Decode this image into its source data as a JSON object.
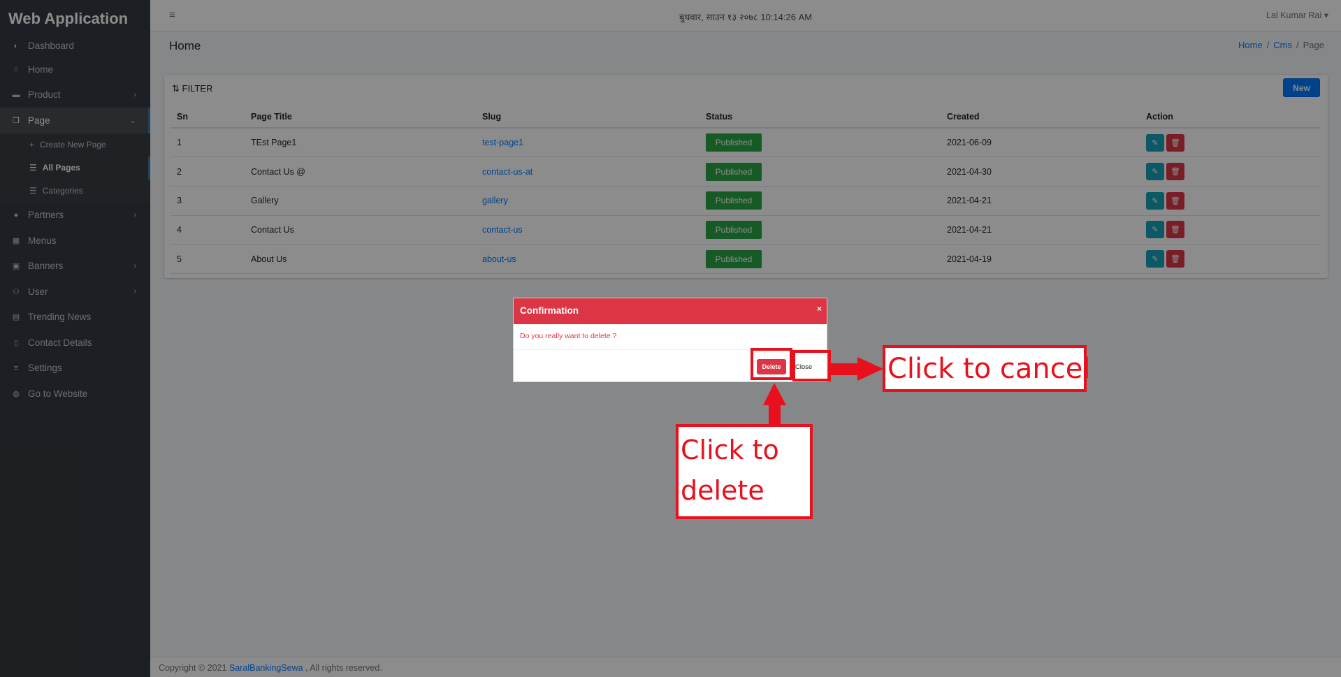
{
  "app": {
    "title": "Web Application"
  },
  "sidebar": {
    "items": [
      {
        "label": "Dashboard",
        "icon": "tachometer-icon"
      },
      {
        "label": "Home",
        "icon": "home-icon"
      },
      {
        "label": "Product",
        "icon": "product-icon",
        "has_children": true
      },
      {
        "label": "Page",
        "icon": "pages-icon",
        "expanded": true
      },
      {
        "label": "Partners",
        "icon": "user-circle-icon",
        "has_children": true
      },
      {
        "label": "Menus",
        "icon": "grid-icon"
      },
      {
        "label": "Banners",
        "icon": "images-icon",
        "has_children": true
      },
      {
        "label": "User",
        "icon": "users-icon",
        "has_children": true
      },
      {
        "label": "Trending News",
        "icon": "newspaper-icon"
      },
      {
        "label": "Contact Details",
        "icon": "address-book-icon"
      },
      {
        "label": "Settings",
        "icon": "sliders-icon"
      },
      {
        "label": "Go to Website",
        "icon": "globe-icon"
      }
    ],
    "page_sub": [
      {
        "label": "Create New Page",
        "icon": "plus-icon"
      },
      {
        "label": "All Pages",
        "icon": "list-icon",
        "active": true
      },
      {
        "label": "Categories",
        "icon": "list-icon"
      }
    ]
  },
  "header": {
    "date": "बुधवार, साउन १३ २०७८ 10:14:26 AM",
    "user": "Lal Kumar Rai"
  },
  "content": {
    "title": "Home",
    "breadcrumb": [
      "Home",
      "Cms",
      "Page"
    ]
  },
  "card": {
    "filter_label": "FILTER",
    "new_label": "New",
    "columns": [
      "Sn",
      "Page Title",
      "Slug",
      "Status",
      "Created",
      "Action"
    ],
    "rows": [
      {
        "sn": "1",
        "title": "TEst Page1",
        "slug": "test-page1",
        "status": "Published",
        "created": "2021-06-09"
      },
      {
        "sn": "2",
        "title": "Contact Us @",
        "slug": "contact-us-at",
        "status": "Published",
        "created": "2021-04-30"
      },
      {
        "sn": "3",
        "title": "Gallery",
        "slug": "gallery",
        "status": "Published",
        "created": "2021-04-21"
      },
      {
        "sn": "4",
        "title": "Contact Us",
        "slug": "contact-us",
        "status": "Published",
        "created": "2021-04-21"
      },
      {
        "sn": "5",
        "title": "About Us",
        "slug": "about-us",
        "status": "Published",
        "created": "2021-04-19"
      }
    ]
  },
  "modal": {
    "title": "Confirmation",
    "close_x": "×",
    "message": "Do you really want to delete ?",
    "delete_label": "Delete",
    "close_label": "Close"
  },
  "annotations": {
    "delete_callout": "Click to delete",
    "cancel_callout": "Click to cancel"
  },
  "footer": {
    "prefix": "Copyright © 2021 ",
    "brand": "SaralBankingSewa",
    "suffix": " , All rights reserved."
  },
  "colors": {
    "sidebar_bg": "#343a40",
    "primary": "#007bff",
    "danger": "#dc3545",
    "success": "#28a745",
    "info": "#17a2b8",
    "annotation_red": "#e8101c"
  }
}
